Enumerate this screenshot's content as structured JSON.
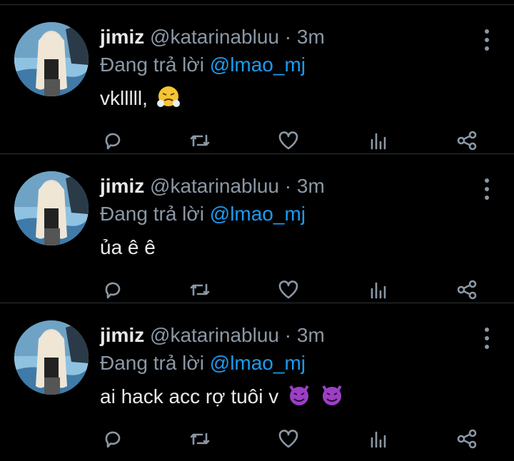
{
  "tweets": [
    {
      "name": "jimiz",
      "handle": "@katarinabluu",
      "separator": "·",
      "time": "3m",
      "reply_prefix": "Đang trả lời",
      "reply_to": "@lmao_mj",
      "text": "vklllll,",
      "emojis": [
        "face-with-steam-from-nose-emoji"
      ]
    },
    {
      "name": "jimiz",
      "handle": "@katarinabluu",
      "separator": "·",
      "time": "3m",
      "reply_prefix": "Đang trả lời",
      "reply_to": "@lmao_mj",
      "text": "ủa ê ê",
      "emojis": []
    },
    {
      "name": "jimiz",
      "handle": "@katarinabluu",
      "separator": "·",
      "time": "3m",
      "reply_prefix": "Đang trả lời",
      "reply_to": "@lmao_mj",
      "text": "ai hack acc rợ tuôi v",
      "emojis": [
        "smiling-face-with-horns-emoji",
        "smiling-face-with-horns-emoji"
      ]
    }
  ],
  "action_icons": [
    "reply-icon",
    "retweet-icon",
    "like-icon",
    "views-icon",
    "share-icon"
  ],
  "colors": {
    "background": "#000000",
    "text": "#e7e9ea",
    "muted": "#8b98a5",
    "mention": "#1d9bf0",
    "divider": "#2f3336"
  }
}
